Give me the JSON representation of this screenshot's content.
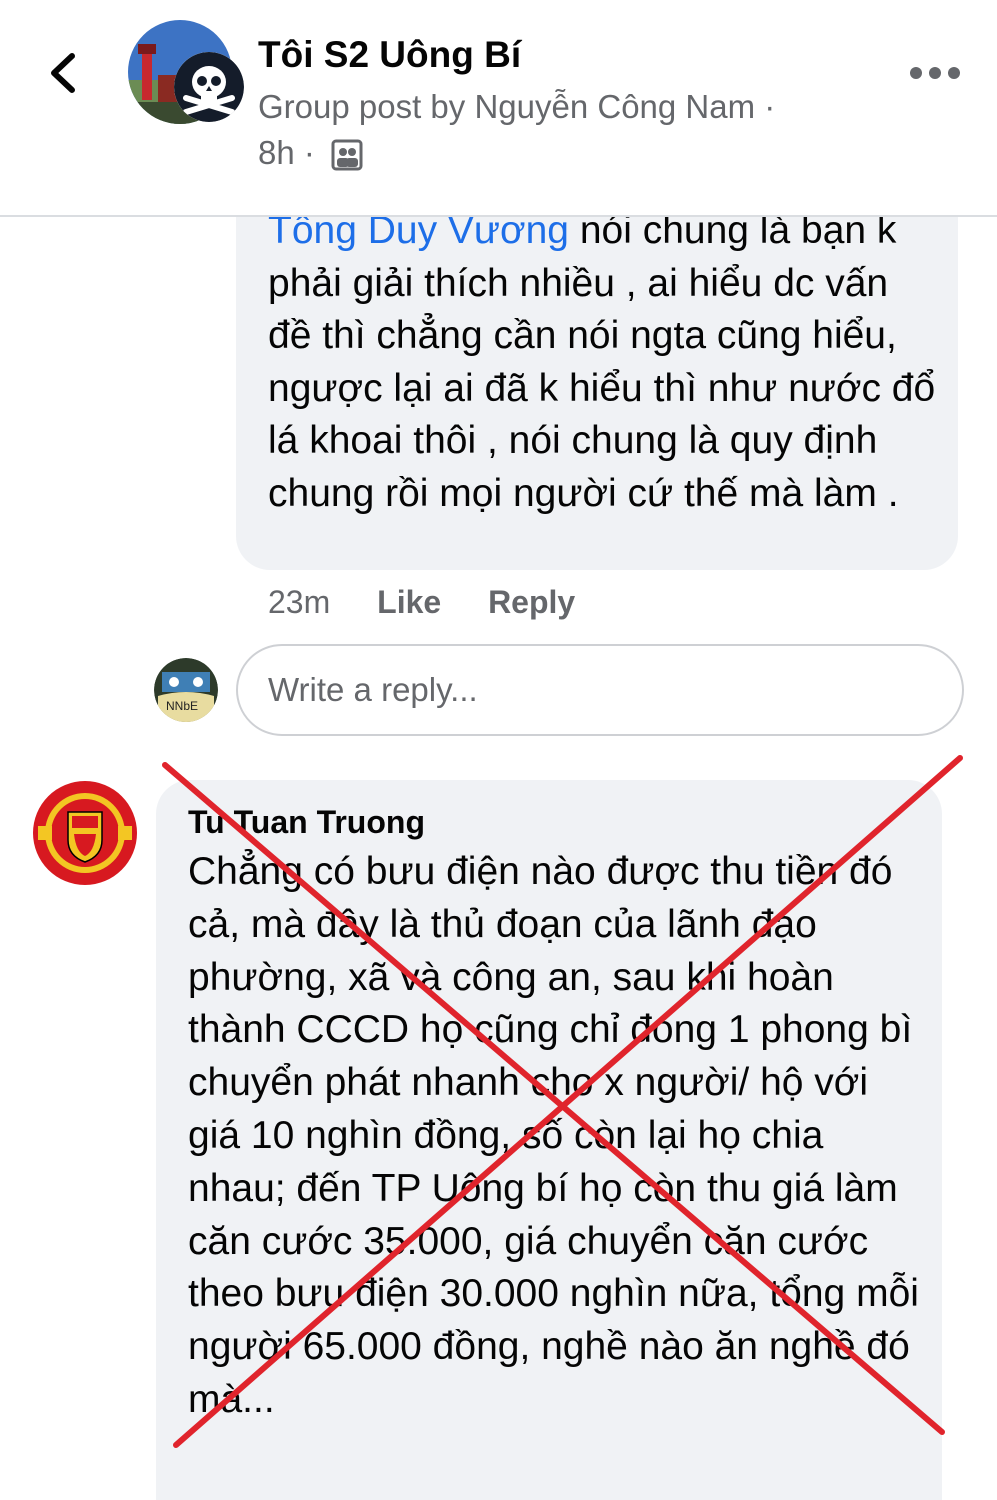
{
  "header": {
    "group_name": "Tôi S2 Uông Bí",
    "meta_line": "Group post by Nguyễn Công Nam ·",
    "time": "8h ·",
    "back_icon": "chevron-left-icon",
    "more_icon": "more-horizontal-icon",
    "audience_icon": "group-audience-icon"
  },
  "comment1": {
    "mention": "Tống Duy Vương",
    "text_after_mention": " nói chung là bạn",
    "text": "k phải giải thích nhiều , ai hiểu dc vấn đề thì chẳng cần nói ngta cũng hiểu, ngược lại ai đã k hiểu thì như nước đổ lá khoai thôi , nói chung là quy định chung rồi mọi người cứ thế mà làm .",
    "time": "23m",
    "like_label": "Like",
    "reply_label": "Reply"
  },
  "reply_box": {
    "placeholder": "Write a reply..."
  },
  "comment2": {
    "author": "Tu Tuan Truong",
    "text": "Chẳng có bưu điện nào được thu tiền đó cả, mà đây là thủ đoạn của lãnh đạo phường, xã và công an, sau khi hoàn thành CCCD họ cũng chỉ đóng 1 phong bì chuyển phát nhanh cho x người/ hộ với giá 10 nghìn đồng, số còn lại họ chia nhau; đến TP Uông bí họ còn thu giá làm căn cước 35.000, giá chuyển căn cước theo bưu điện 30.000 nghìn nữa, tổng mỗi người 65.000 đồng, nghề nào ăn nghề đó mà..."
  },
  "colors": {
    "mention": "#1d6ee8",
    "bubble": "#f0f2f5",
    "cross": "#e0242c",
    "secondary_text": "#65676b"
  }
}
